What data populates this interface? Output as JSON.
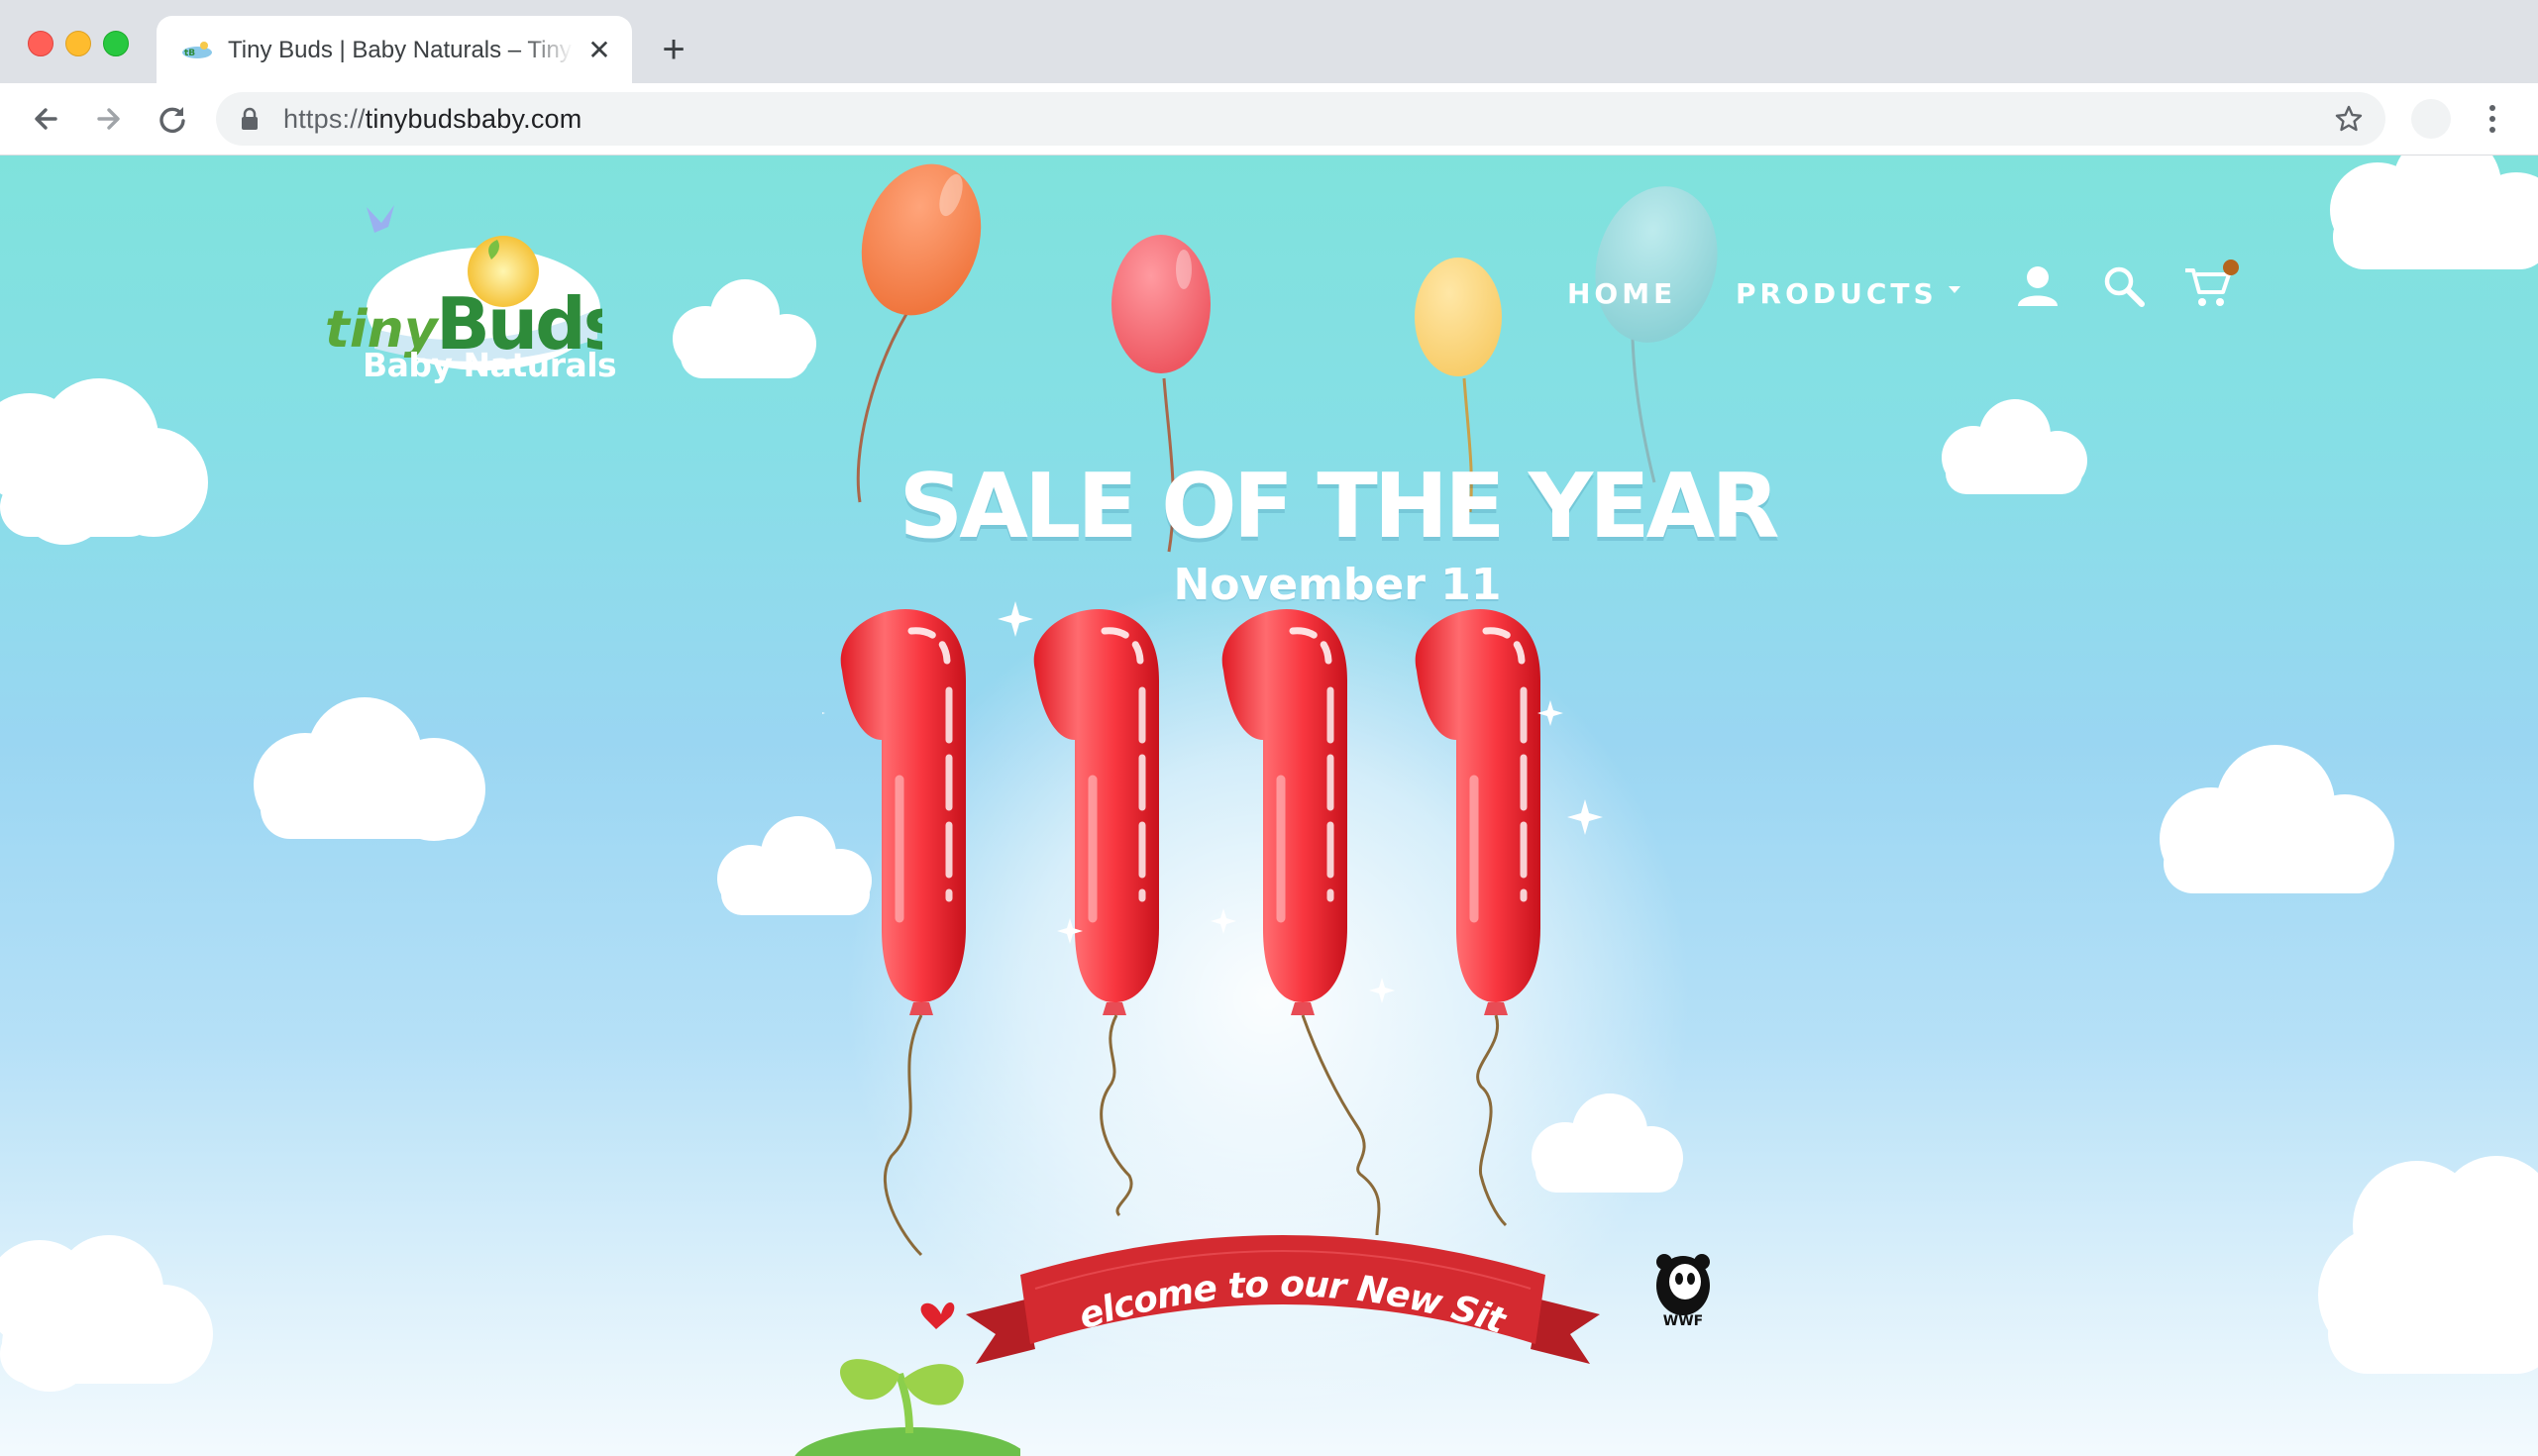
{
  "browser": {
    "tab": {
      "title": "Tiny Buds | Baby Naturals – Tiny Buds Baby Naturals",
      "close_label": "✕"
    },
    "new_tab_label": "+",
    "url": {
      "scheme": "https://",
      "host": "tinybudsbaby.com"
    }
  },
  "site": {
    "logo": {
      "brand_a": "tiny",
      "brand_b": "Buds",
      "trademark": "™",
      "tagline": "Baby Naturals"
    },
    "nav": {
      "home": "HOME",
      "products": "PRODUCTS"
    },
    "cart_badge_color": "#b5651d"
  },
  "hero": {
    "headline": "SALE OF THE YEAR",
    "date": "November 11",
    "big_number": "1111",
    "ribbon_text": "Welcome to our New Site",
    "partner_logo": {
      "name": "panda-icon",
      "label": "WWF"
    }
  },
  "colors": {
    "sky_top": "#7fe2dc",
    "sky_bottom": "#f3fafe",
    "balloon_red": "#f5363e",
    "ribbon_red": "#d42a30",
    "logo_green": "#2e8b3a"
  }
}
